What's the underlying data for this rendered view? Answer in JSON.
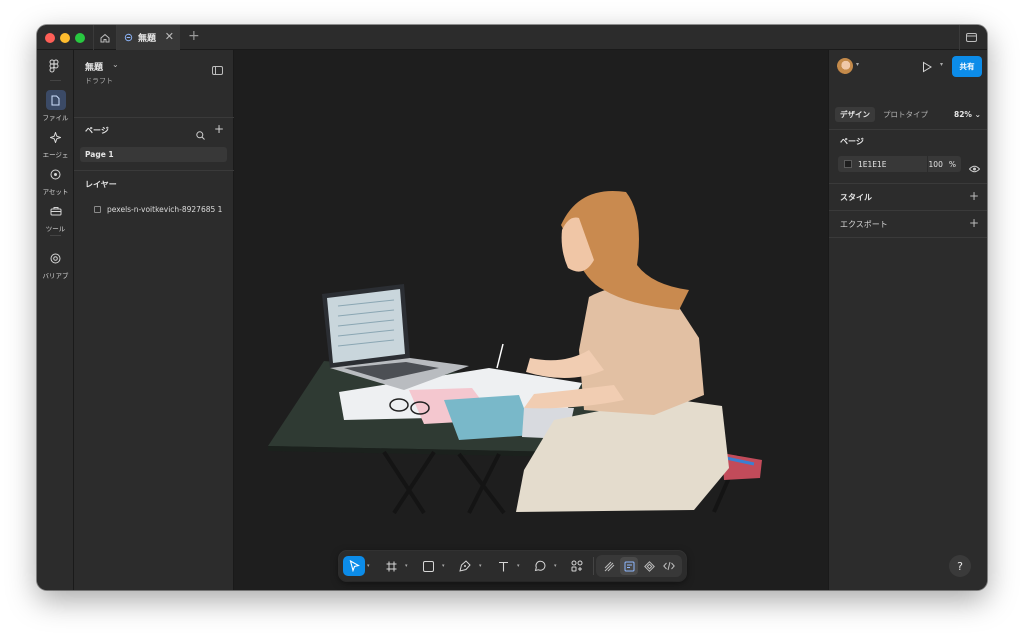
{
  "titlebar": {
    "tab_title": "無題",
    "tab_close": "✕",
    "tab_add": "+"
  },
  "rail": {
    "items": [
      {
        "label": "ファイル"
      },
      {
        "label": "エージェ"
      },
      {
        "label": "アセット"
      },
      {
        "label": "ツール"
      },
      {
        "label": "バリアブ"
      }
    ]
  },
  "left_panel": {
    "file_title": "無題",
    "file_subtitle": "ドラフト",
    "pages_label": "ページ",
    "pages": [
      "Page 1"
    ],
    "layers_label": "レイヤー",
    "layers": [
      "pexels-n-voitkevich-8927685 1"
    ]
  },
  "right_panel": {
    "share_label": "共有",
    "tabs": [
      "デザイン",
      "プロトタイプ"
    ],
    "zoom": "82%",
    "page_section": "ページ",
    "fill_hex": "1E1E1E",
    "fill_opacity": "100",
    "fill_unit": "%",
    "styles_label": "スタイル",
    "export_label": "エクスポート",
    "help_label": "?"
  },
  "icons": {
    "titlebar": [
      "home-icon",
      "file-icon",
      "sidebar-icon"
    ],
    "rail": [
      "figma-logo-icon",
      "file-icon",
      "agent-icon",
      "asset-icon",
      "toolbox-icon",
      "variables-icon"
    ],
    "toolbar": [
      "move-icon",
      "frame-icon",
      "rectangle-icon",
      "pen-icon",
      "text-icon",
      "comment-icon",
      "actions-icon",
      "draw-icon",
      "design-icon",
      "dev-icon",
      "code-icon"
    ]
  },
  "colors": {
    "canvas_bg": "#1E1E1E",
    "panel_bg": "#2C2C2C",
    "accent": "#0C8CE9"
  }
}
